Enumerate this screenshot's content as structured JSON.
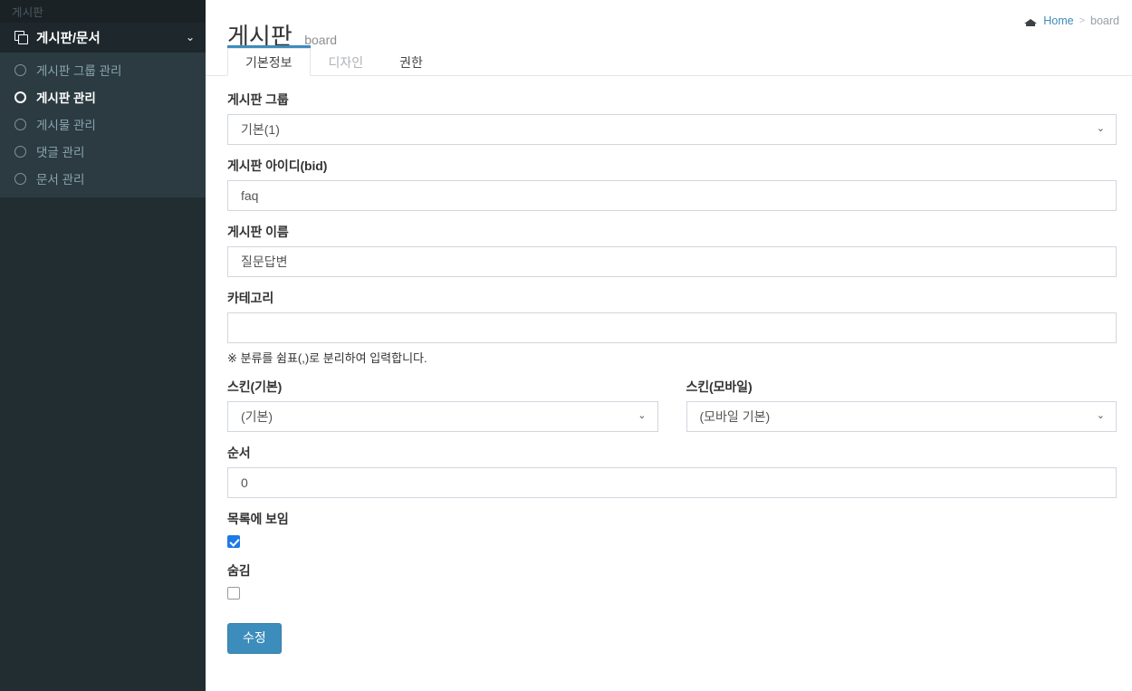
{
  "sidebar": {
    "brand": "게시판",
    "tree": {
      "label": "게시판/문서",
      "icon": "clone-icon",
      "chevron": "⌄"
    },
    "items": [
      {
        "label": "게시판 그룹 관리",
        "active": false
      },
      {
        "label": "게시판 관리",
        "active": true
      },
      {
        "label": "게시물 관리",
        "active": false
      },
      {
        "label": "댓글 관리",
        "active": false
      },
      {
        "label": "문서 관리",
        "active": false
      }
    ]
  },
  "header": {
    "title": "게시판",
    "subtitle": "board",
    "breadcrumb": {
      "home_icon": "home-icon",
      "home_label": "Home",
      "separator": ">",
      "current": "board"
    }
  },
  "tabs": [
    {
      "label": "기본정보",
      "active": true,
      "muted": false
    },
    {
      "label": "디자인",
      "active": false,
      "muted": true
    },
    {
      "label": "권한",
      "active": false,
      "muted": false
    }
  ],
  "form": {
    "group": {
      "label": "게시판 그룹",
      "value": "기본(1)",
      "caret": "⌄"
    },
    "bid": {
      "label_main": "게시판 아이디",
      "label_suffix": "(bid)",
      "value": "faq"
    },
    "board_name": {
      "label": "게시판 이름",
      "value": "질문답변"
    },
    "category": {
      "label": "카테고리",
      "value": "",
      "hint": "※ 분류를 쉼표(,)로 분리하여 입력합니다."
    },
    "skin_default": {
      "label": "스킨(기본)",
      "value": "(기본)",
      "caret": "⌄"
    },
    "skin_mobile": {
      "label": "스킨(모바일)",
      "value": "(모바일 기본)",
      "caret": "⌄"
    },
    "order": {
      "label": "순서",
      "value": "0"
    },
    "show_in_list": {
      "label": "목록에 보임",
      "checked": true
    },
    "hidden": {
      "label": "숨김",
      "checked": false
    },
    "submit_label": "수정"
  },
  "colors": {
    "sidebar_bg": "#222d32",
    "sidebar_submenu_bg": "#2c3b41",
    "sidebar_header_bg": "#1e282c",
    "accent": "#3c8dbc",
    "checkbox_checked": "#1e7ae8"
  }
}
